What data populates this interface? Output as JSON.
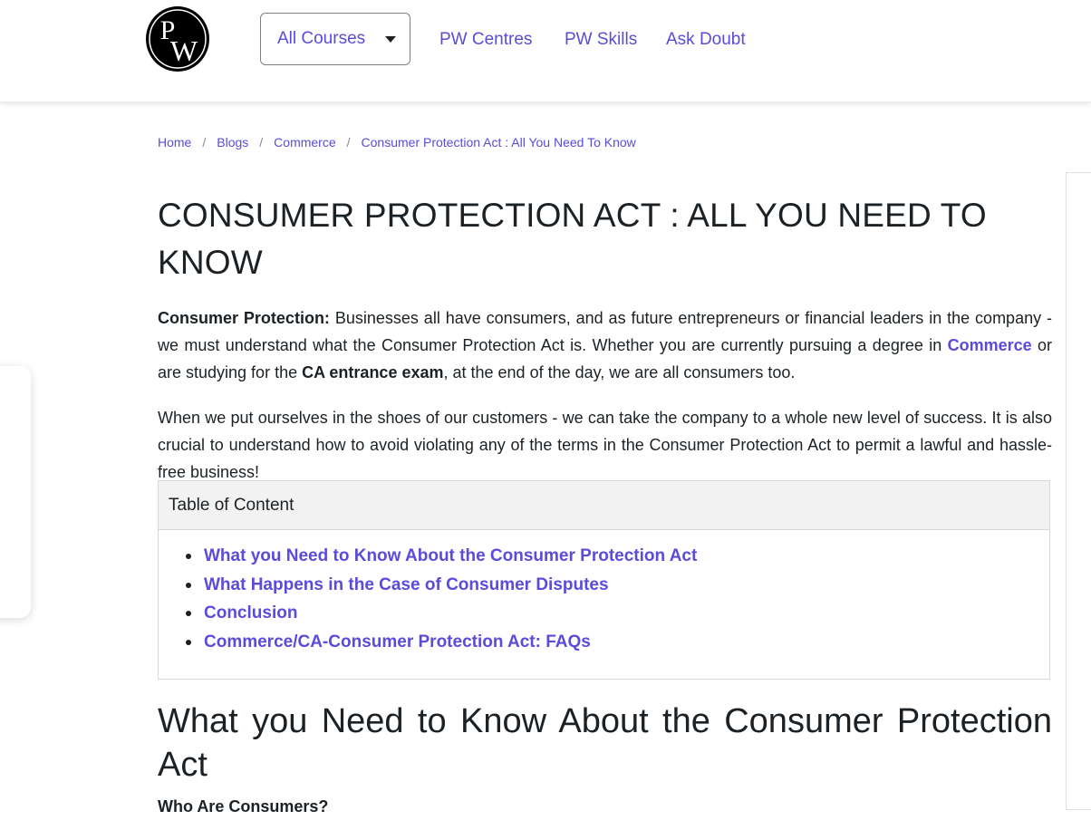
{
  "header": {
    "logo_text": "PW",
    "courses_label": "All Courses",
    "nav": [
      "PW Centres",
      "PW Skills",
      "Ask Doubt"
    ]
  },
  "breadcrumb": [
    "Home",
    "Blogs",
    "Commerce",
    "Consumer Protection Act : All You Need To Know"
  ],
  "article": {
    "title": "CONSUMER PROTECTION ACT : ALL YOU NEED TO KNOW",
    "p1": {
      "lead": "Consumer Protection:",
      "t1": " Businesses all have consumers, and as future entrepreneurs or financial leaders in the company - we must understand what the Consumer Protection Act is. Whether you are currently pursuing a degree in ",
      "link": "Commerce",
      "t2": " or are studying for the ",
      "bold": "CA entrance exam",
      "t3": ", at the end of the day, we are all consumers too."
    },
    "p2": "When we put ourselves in the shoes of our customers - we can take the company to a whole new level of success. It is also crucial to understand how to avoid violating any of the terms in the Consumer Protection Act to permit a lawful and hassle-free business!",
    "toc": {
      "heading": "Table of Content",
      "items": [
        "What you Need to Know About the Consumer Protection Act",
        "What Happens in the Case of Consumer Disputes",
        "Conclusion",
        "Commerce/CA-Consumer Protection Act: FAQs"
      ]
    },
    "section_heading": "What you Need to Know About the Consumer Protection Act",
    "subheading": "Who Are Consumers?"
  },
  "social": [
    {
      "icon": "youtube-icon",
      "color": "#ff0000"
    },
    {
      "icon": "instagram-icon",
      "color": "#d6249f"
    },
    {
      "icon": "telegram-icon",
      "color": "#2aabee"
    },
    {
      "icon": "facebook-icon",
      "color": "#1877f2"
    },
    {
      "icon": "twitter-icon",
      "color": "#1da1f2"
    }
  ],
  "colors": {
    "accent": "#5a4bda",
    "text": "#1b2124"
  }
}
